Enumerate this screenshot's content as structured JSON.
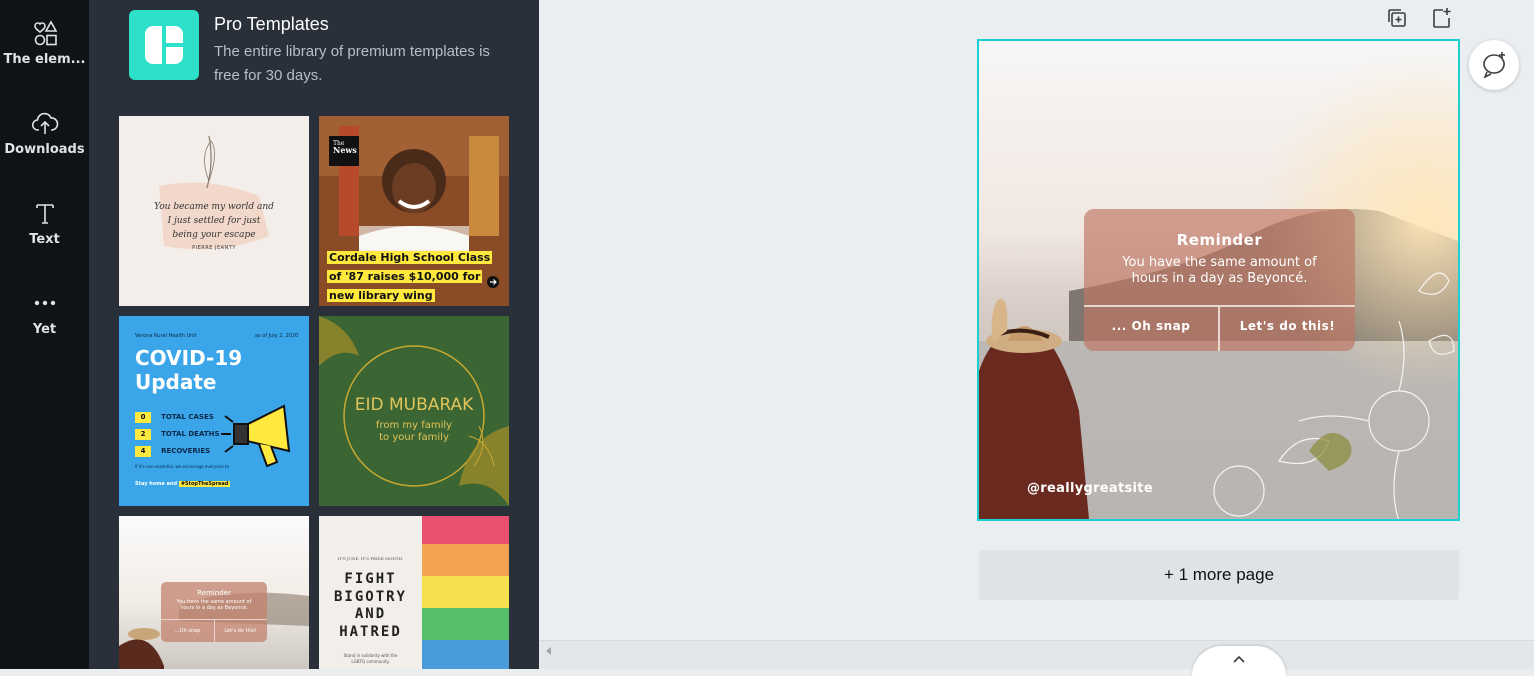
{
  "rail": {
    "items": [
      {
        "label": "The elem..."
      },
      {
        "label": "Downloads"
      },
      {
        "label": "Text"
      },
      {
        "label": "Yet"
      }
    ]
  },
  "promo": {
    "title": "Pro Templates",
    "description": "The entire library of premium templates is free for 30 days."
  },
  "templates": {
    "quote": {
      "lines": [
        "You became my world and",
        "I just settled for just",
        "being your escape"
      ],
      "author": "PIERRE JEANTY"
    },
    "news": {
      "badge_top": "The",
      "badge_bottom": "News",
      "headline": [
        "Cordale High School Class",
        "of '87 raises $10,000 for",
        "new library wing"
      ]
    },
    "covid": {
      "org": "Verona Rural Health Unit",
      "date": "as of July 2, 2020",
      "title": [
        "COVID-19",
        "Update"
      ],
      "stats": [
        {
          "num": "0",
          "label": "TOTAL CASES"
        },
        {
          "num": "2",
          "label": "TOTAL DEATHS"
        },
        {
          "num": "4",
          "label": "RECOVERIES"
        }
      ],
      "note": "If it's non-essential, we encourage everyone to",
      "footer_a": "Stay home and",
      "footer_b": "#StopTheSpread"
    },
    "eid": {
      "title": "EID MUBARAK",
      "sub1": "from my family",
      "sub2": "to your family"
    },
    "reminder_small": {
      "title": "Reminder",
      "body": [
        "You have the same amount of",
        "hours in a day as Beyoncé."
      ],
      "btn_a": "...Oh snap",
      "btn_b": "Let's do this!"
    },
    "pride": {
      "top": "IT'S JUNE. IT'S PRIDE MONTH.",
      "lines": [
        "FIGHT",
        "BIGOTRY",
        "AND",
        "HATRED"
      ],
      "bottom": [
        "Stand in solidarity with the",
        "LGBTQ community."
      ]
    }
  },
  "design": {
    "title": "Reminder",
    "body": [
      "You have the same amount of",
      "hours in a day as Beyoncé."
    ],
    "btn_a": "... Oh snap",
    "btn_b": "Let's do this!",
    "handle": "@reallygreatsite"
  },
  "more_page": "+ 1 more page",
  "icons": {
    "copy": "duplicate-page-icon",
    "add": "add-page-icon",
    "comment": "add-comment-icon",
    "collapse": "chevron-left-icon",
    "expand": "chevron-up-icon"
  },
  "colors": {
    "rail_bg": "#0e1318",
    "panel_bg": "#293039",
    "accent": "#2de0c9",
    "selection": "#1bd1cf"
  }
}
